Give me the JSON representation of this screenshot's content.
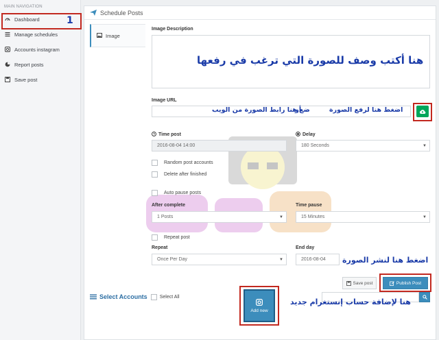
{
  "sidebar": {
    "heading": "MAIN NAVIGATION",
    "items": [
      {
        "label": "Dashboard",
        "icon": "dashboard-icon"
      },
      {
        "label": "Manage schedules",
        "icon": "list-icon"
      },
      {
        "label": "Accounts instagram",
        "icon": "instagram-icon"
      },
      {
        "label": "Report posts",
        "icon": "pie-chart-icon"
      },
      {
        "label": "Save post",
        "icon": "save-icon"
      }
    ],
    "marker": "1"
  },
  "panel": {
    "title": "Schedule Posts",
    "tab": "Image"
  },
  "form": {
    "image_description_label": "Image Description",
    "image_description_note": "هنا أكتب وصف للصورة التي ترغب في رفعها",
    "image_url_label": "Image URL",
    "image_url_note": "ضع هنا رابط الصورة من الويب",
    "or_word": "أو",
    "upload_note": "اضغط هنا لرفع الصورة",
    "time_post_label": "Time post",
    "time_post_value": "2016-08-04 14:00",
    "delay_label": "Delay",
    "delay_value": "180 Seconds",
    "random_accounts": "Random post accounts",
    "delete_after": "Delete after finished",
    "auto_pause": "Auto pause posts",
    "after_complete_label": "After complete",
    "after_complete_value": "1 Posts",
    "time_pause_label": "Time pause",
    "time_pause_value": "15 Minutes",
    "repeat_post": "Repeat post",
    "repeat_label": "Repeat",
    "repeat_value": "Once Per Day",
    "end_day_label": "End day",
    "end_day_value": "2016-08-04",
    "publish_note": "اضغط هنا لنشر الصورة",
    "save_post_button": "Save post",
    "publish_button": "Publish Post"
  },
  "accounts": {
    "title": "Select Accounts",
    "select_all": "Select All",
    "add_new": "Add new",
    "add_note": "هنا لإضافة حساب إنستغرام جديد"
  },
  "colors": {
    "accent": "#3c8dbc",
    "green": "#00a65a",
    "annotation": "#c2281f",
    "arabic": "#1a3ba8"
  }
}
